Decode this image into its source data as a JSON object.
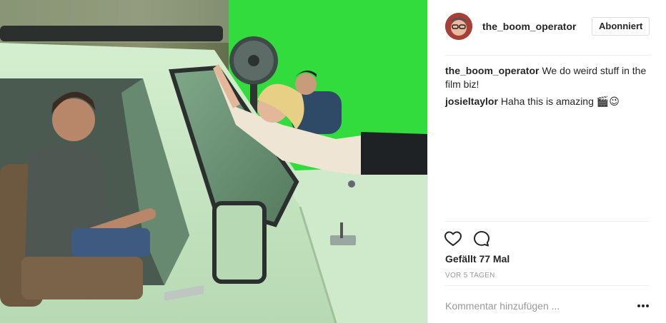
{
  "post": {
    "username": "the_boom_operator",
    "follow_label": "Abonniert",
    "comments": [
      {
        "user": "the_boom_operator",
        "text": "We do weird stuff in the film biz!"
      },
      {
        "user": "josieltaylor",
        "text": "Haha this is amazing 🎬😉"
      }
    ],
    "likes_text": "Gefällt 77 Mal",
    "timestamp": "VOR 5 TAGEN",
    "comment_placeholder": "Kommentar hinzufügen ...",
    "icons": {
      "like": "heart-icon",
      "comment": "speech-bubble-icon",
      "more": "more-options-icon"
    }
  },
  "colors": {
    "green_screen": "#2fd83a",
    "truck_body": "#c6e6c2",
    "text_primary": "#262626",
    "text_secondary": "#999999"
  }
}
